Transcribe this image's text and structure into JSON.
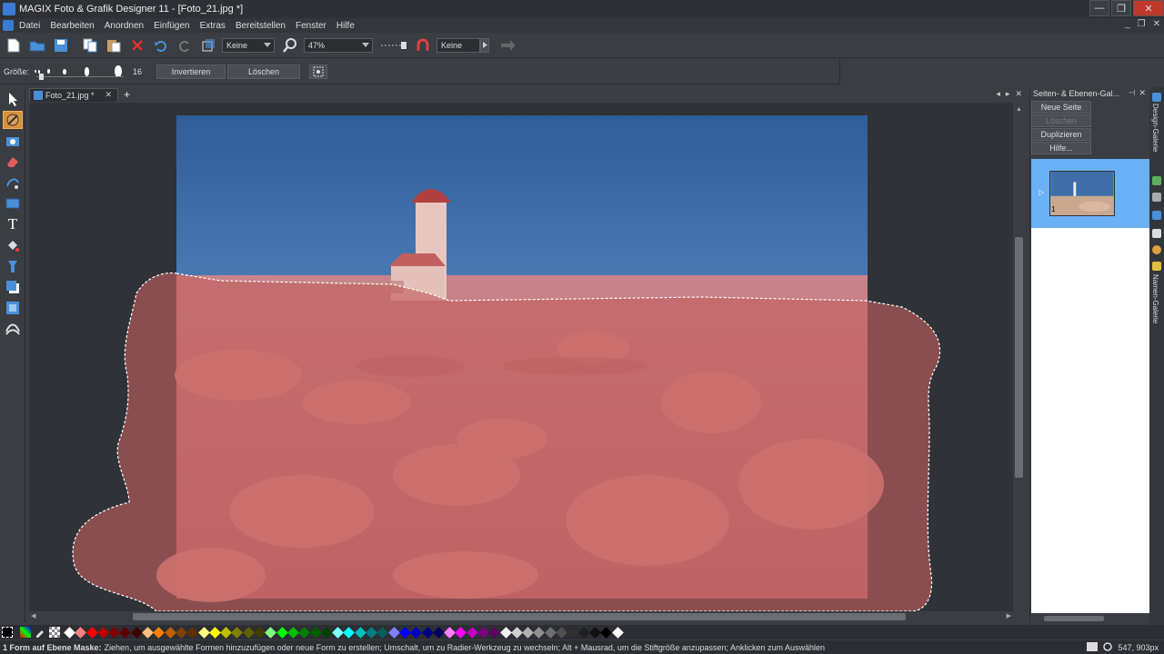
{
  "window": {
    "title": "MAGIX Foto & Grafik Designer 11 - [Foto_21.jpg *]"
  },
  "menu": [
    "Datei",
    "Bearbeiten",
    "Anordnen",
    "Einfügen",
    "Extras",
    "Bereitstellen",
    "Fenster",
    "Hilfe"
  ],
  "toolbar": {
    "fill_combo": "Keine",
    "zoom_combo": "47%",
    "line_combo": "Keine"
  },
  "toolbar2": {
    "size_label": "Größe:",
    "size_value": "16",
    "invert_label": "Invertieren",
    "delete_label": "Löschen"
  },
  "document": {
    "tab_label": "Foto_21.jpg *"
  },
  "right_panel": {
    "title": "Seiten- & Ebenen-Gal...",
    "btn_new_page": "Neue Seite",
    "btn_delete": "Löschen",
    "btn_duplicate": "Duplizieren",
    "btn_help": "Hilfe...",
    "page_number": "1"
  },
  "side_tabs": {
    "design": "Design-Galerie",
    "names": "Namen-Galerie"
  },
  "palette": {
    "colors": [
      "#ffffff",
      "#ff8080",
      "#ff0000",
      "#c00000",
      "#800000",
      "#600000",
      "#400000",
      "#ffc080",
      "#ff8000",
      "#c06000",
      "#804000",
      "#603000",
      "#ffff80",
      "#ffff00",
      "#c0c000",
      "#808000",
      "#606000",
      "#404000",
      "#80ff80",
      "#00ff00",
      "#00c000",
      "#008000",
      "#006000",
      "#004000",
      "#80ffff",
      "#00ffff",
      "#00c0c0",
      "#008080",
      "#006060",
      "#8080ff",
      "#0000ff",
      "#0000c0",
      "#000080",
      "#000060",
      "#ff80ff",
      "#ff00ff",
      "#c000c0",
      "#800080",
      "#600060",
      "#f0f0f0",
      "#d0d0d0",
      "#b0b0b0",
      "#909090",
      "#707070",
      "#505050",
      "#303030",
      "#202020",
      "#101010",
      "#000000",
      "#ffffff"
    ]
  },
  "status": {
    "bold": "1 Form auf Ebene Maske:",
    "text": "Ziehen, um ausgewählte Formen hinzuzufügen oder neue Form zu erstellen; Umschalt, um zu Radier-Werkzeug zu wechseln; Alt + Mausrad, um die Stiftgröße anzupassen; Anklicken zum Auswählen",
    "coords": "547, 903px"
  }
}
